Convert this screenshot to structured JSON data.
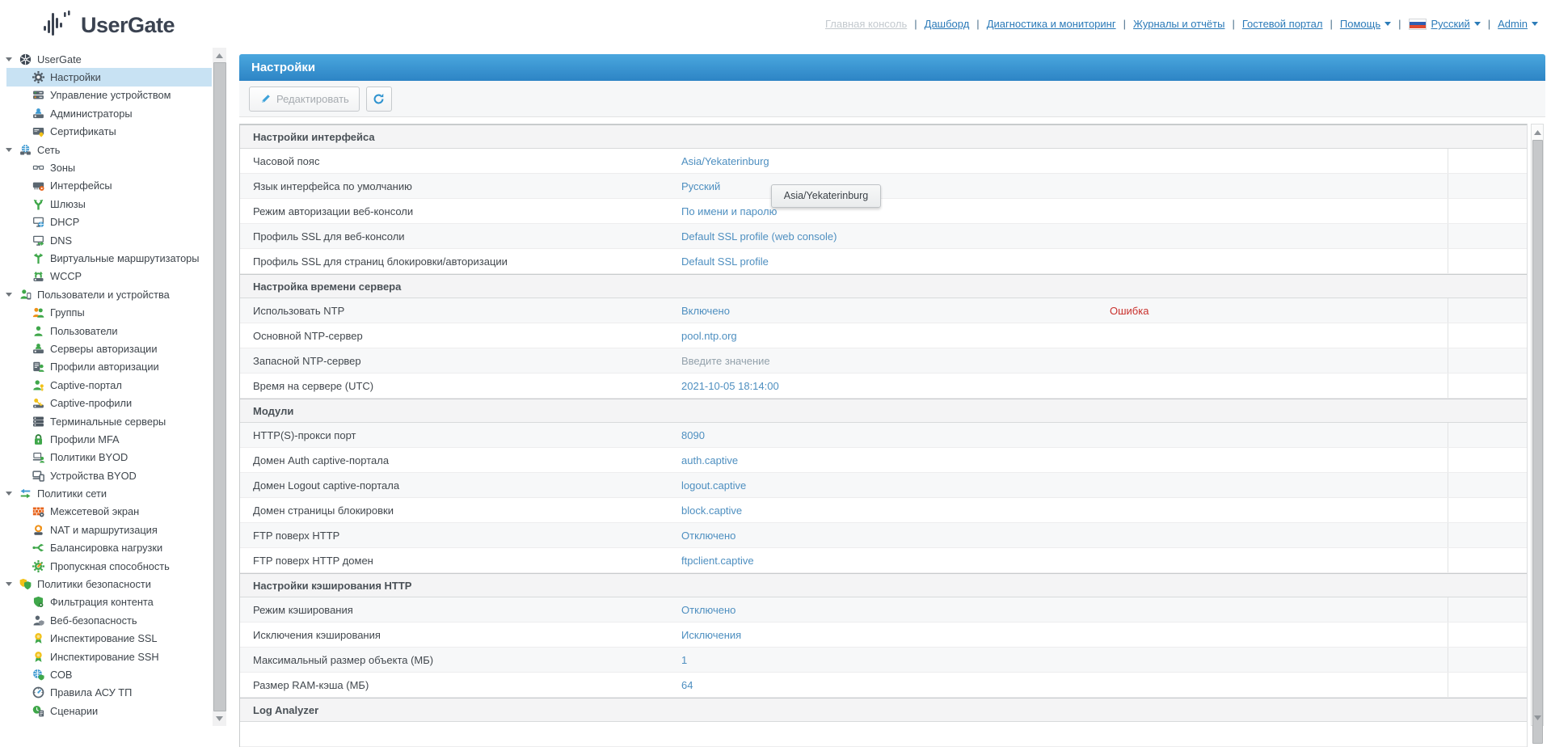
{
  "header": {
    "logo_text": "UserGate",
    "nav": [
      {
        "label": "Главная консоль",
        "state": "disabled"
      },
      {
        "label": "Дашборд"
      },
      {
        "label": "Диагностика и мониторинг"
      },
      {
        "label": "Журналы и отчёты"
      },
      {
        "label": "Гостевой портал"
      },
      {
        "label": "Помощь",
        "dropdown": true
      },
      {
        "label": "Русский",
        "dropdown": true,
        "flag": true
      },
      {
        "label": "Admin",
        "dropdown": true
      }
    ]
  },
  "sidebar": {
    "groups": [
      {
        "label": "UserGate",
        "icon": "usergate-hub",
        "items": [
          {
            "label": "Настройки",
            "icon": "gear",
            "selected": true
          },
          {
            "label": "Управление устройством",
            "icon": "device-management"
          },
          {
            "label": "Администраторы",
            "icon": "administrators"
          },
          {
            "label": "Сертификаты",
            "icon": "certificates"
          }
        ]
      },
      {
        "label": "Сеть",
        "icon": "network-globe",
        "items": [
          {
            "label": "Зоны",
            "icon": "zones"
          },
          {
            "label": "Интерфейсы",
            "icon": "interfaces"
          },
          {
            "label": "Шлюзы",
            "icon": "gateways"
          },
          {
            "label": "DHCP",
            "icon": "dhcp"
          },
          {
            "label": "DNS",
            "icon": "dns"
          },
          {
            "label": "Виртуальные маршрутизаторы",
            "icon": "virtual-routers"
          },
          {
            "label": "WCCP",
            "icon": "wccp"
          }
        ]
      },
      {
        "label": "Пользователи и устройства",
        "icon": "users-devices",
        "items": [
          {
            "label": "Группы",
            "icon": "groups"
          },
          {
            "label": "Пользователи",
            "icon": "users"
          },
          {
            "label": "Серверы авторизации",
            "icon": "auth-servers"
          },
          {
            "label": "Профили авторизации",
            "icon": "auth-profiles"
          },
          {
            "label": "Captive-портал",
            "icon": "captive-portal"
          },
          {
            "label": "Captive-профили",
            "icon": "captive-profiles"
          },
          {
            "label": "Терминальные серверы",
            "icon": "terminal-servers"
          },
          {
            "label": "Профили MFA",
            "icon": "mfa-profiles"
          },
          {
            "label": "Политики BYOD",
            "icon": "byod-policies"
          },
          {
            "label": "Устройства BYOD",
            "icon": "byod-devices"
          }
        ]
      },
      {
        "label": "Политики сети",
        "icon": "network-policies",
        "items": [
          {
            "label": "Межсетевой экран",
            "icon": "firewall"
          },
          {
            "label": "NAT и маршрутизация",
            "icon": "nat-routing"
          },
          {
            "label": "Балансировка нагрузки",
            "icon": "load-balancing"
          },
          {
            "label": "Пропускная способность",
            "icon": "bandwidth"
          }
        ]
      },
      {
        "label": "Политики безопасности",
        "icon": "security-policies",
        "items": [
          {
            "label": "Фильтрация контента",
            "icon": "content-filtering"
          },
          {
            "label": "Веб-безопасность",
            "icon": "web-security"
          },
          {
            "label": "Инспектирование SSL",
            "icon": "ssl-inspection"
          },
          {
            "label": "Инспектирование SSH",
            "icon": "ssh-inspection"
          },
          {
            "label": "СОВ",
            "icon": "ids"
          },
          {
            "label": "Правила АСУ ТП",
            "icon": "scada-rules"
          },
          {
            "label": "Сценарии",
            "icon": "scenarios"
          }
        ]
      }
    ]
  },
  "main": {
    "title": "Настройки",
    "toolbar": {
      "edit_label": "Редактировать"
    },
    "tooltip": "Asia/Yekaterinburg",
    "sections": [
      {
        "title": "Настройки интерфейса",
        "rows": [
          {
            "label": "Часовой пояс",
            "value": "Asia/Yekaterinburg"
          },
          {
            "label": "Язык интерфейса по умолчанию",
            "value": "Русский"
          },
          {
            "label": "Режим авторизации веб-консоли",
            "value": "По имени и паролю"
          },
          {
            "label": "Профиль SSL для веб-консоли",
            "value": "Default SSL profile (web console)"
          },
          {
            "label": "Профиль SSL для страниц блокировки/авторизации",
            "value": "Default SSL profile"
          }
        ]
      },
      {
        "title": "Настройка времени сервера",
        "rows": [
          {
            "label": "Использовать NTP",
            "value": "Включено",
            "error": "Ошибка"
          },
          {
            "label": "Основной NTP-сервер",
            "value": "pool.ntp.org"
          },
          {
            "label": "Запасной NTP-сервер",
            "value": "Введите значение",
            "muted": true
          },
          {
            "label": "Время на сервере (UTC)",
            "value": "2021-10-05 18:14:00"
          }
        ]
      },
      {
        "title": "Модули",
        "rows": [
          {
            "label": "HTTP(S)-прокси порт",
            "value": "8090"
          },
          {
            "label": "Домен Auth captive-портала",
            "value": "auth.captive"
          },
          {
            "label": "Домен Logout captive-портала",
            "value": "logout.captive"
          },
          {
            "label": "Домен страницы блокировки",
            "value": "block.captive"
          },
          {
            "label": "FTP поверх HTTP",
            "value": "Отключено"
          },
          {
            "label": "FTP поверх HTTP домен",
            "value": "ftpclient.captive"
          }
        ]
      },
      {
        "title": "Настройки кэширования HTTP",
        "rows": [
          {
            "label": "Режим кэширования",
            "value": "Отключено"
          },
          {
            "label": "Исключения кэширования",
            "value": "Исключения"
          },
          {
            "label": "Максимальный размер объекта (МБ)",
            "value": "1"
          },
          {
            "label": "Размер RAM-кэша (МБ)",
            "value": "64"
          }
        ]
      },
      {
        "title": "Log Analyzer",
        "rows": []
      }
    ]
  },
  "colors": {
    "accent_blue": "#2d84c5",
    "link_blue": "#2b7ab8",
    "value_blue": "#4e8fc0",
    "error_red": "#c9302c",
    "selected_row": "#c8e2f3",
    "flag": [
      "#ffffff",
      "#2f5fb3",
      "#e04b30"
    ]
  }
}
